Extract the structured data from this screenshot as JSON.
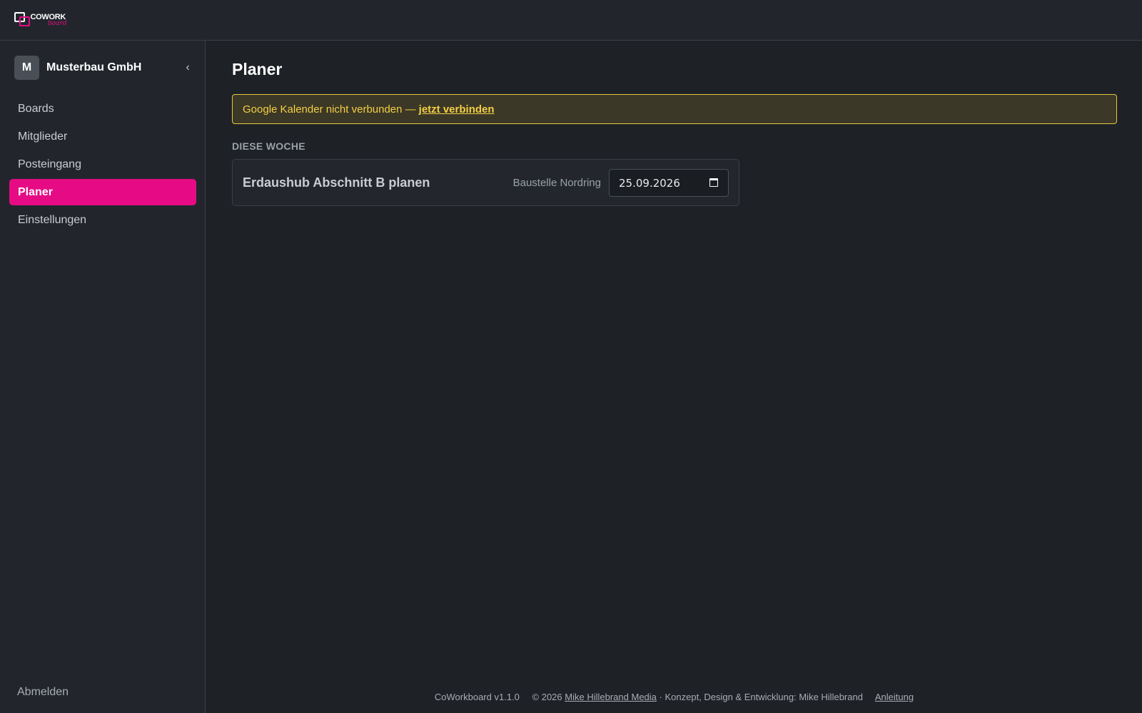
{
  "header": {
    "logo_text": "COWORK",
    "logo_sub": "board"
  },
  "sidebar": {
    "org": {
      "avatar_letter": "M",
      "name": "Musterbau GmbH"
    },
    "collapse_icon": "chevron-left-icon",
    "items": [
      {
        "label": "Boards",
        "active": false
      },
      {
        "label": "Mitglieder",
        "active": false
      },
      {
        "label": "Posteingang",
        "active": false
      },
      {
        "label": "Planer",
        "active": true
      },
      {
        "label": "Einstellungen",
        "active": false
      }
    ],
    "logout_label": "Abmelden"
  },
  "main": {
    "title": "Planer",
    "banner": {
      "text": "Google Kalender nicht verbunden —",
      "link_label": "jetzt verbinden"
    },
    "section_label": "DIESE WOCHE",
    "tasks": [
      {
        "title": "Erdaushub Abschnitt B planen",
        "project": "Baustelle Nordring",
        "date": "25.09.2026"
      }
    ]
  },
  "footer": {
    "version": "CoWorkboard v1.1.0",
    "copyright": "© 2026",
    "company_link": "Mike Hillebrand Media",
    "credits": "· Konzept, Design & Entwicklung: Mike Hillebrand",
    "guide_link": "Anleitung"
  },
  "colors": {
    "accent": "#e60b84",
    "background": "#1e2126",
    "panel": "#22262c",
    "warning": "#f3cf45"
  }
}
